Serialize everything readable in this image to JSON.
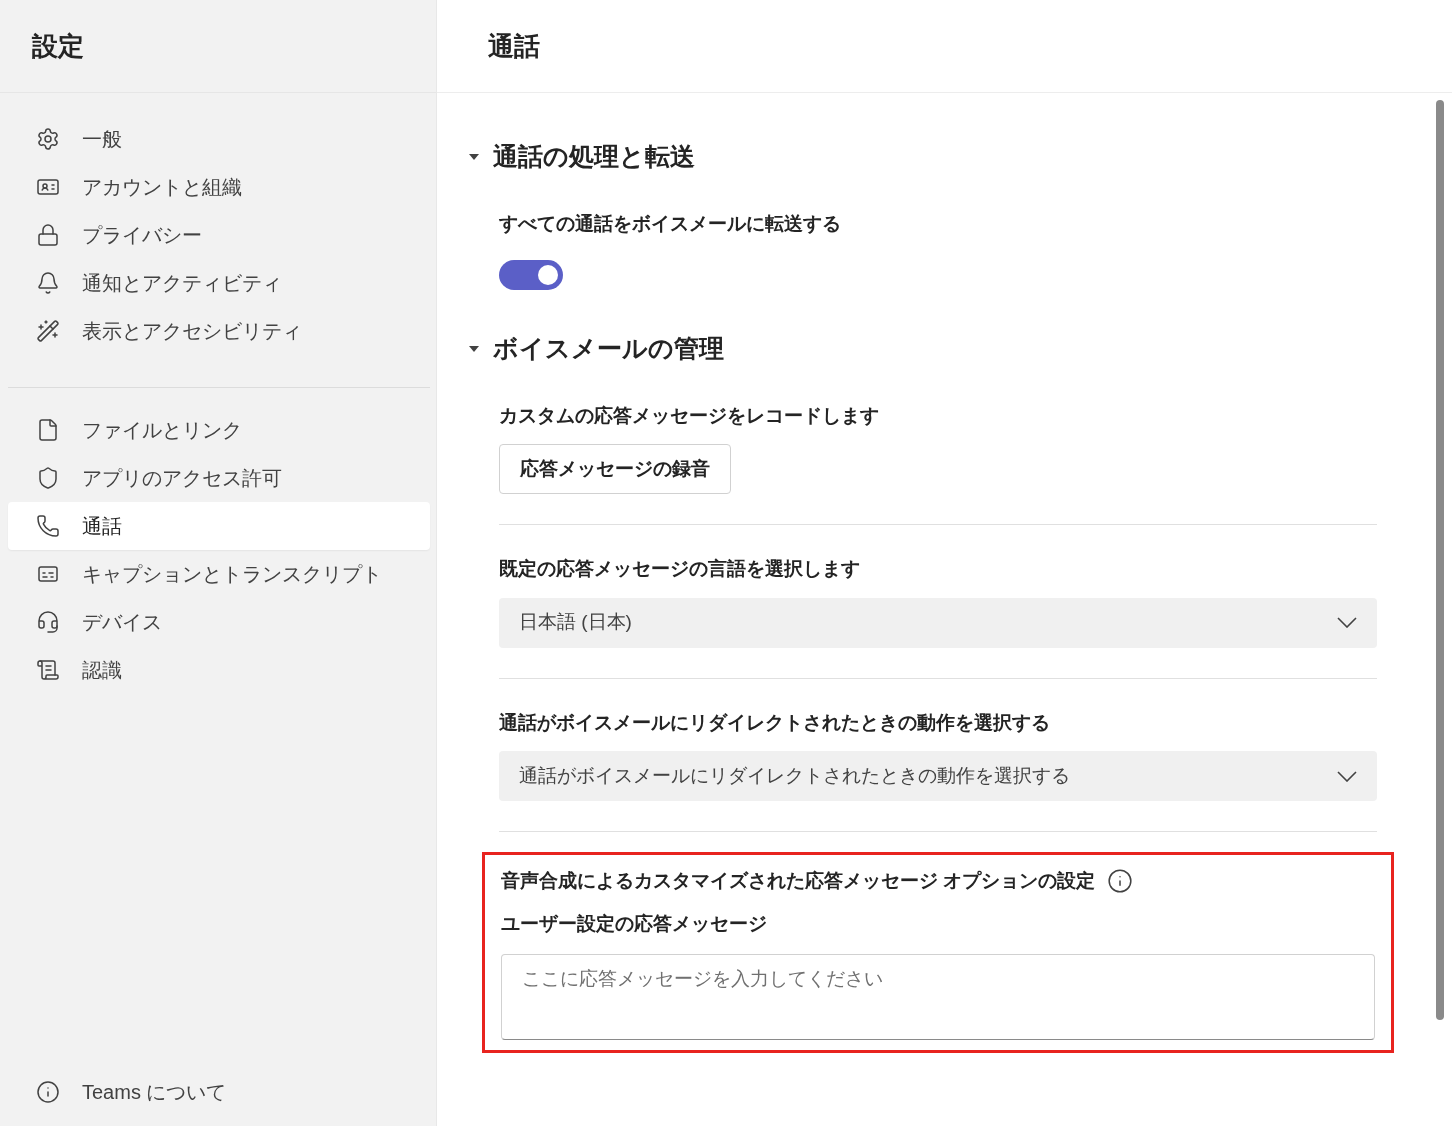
{
  "sidebar": {
    "title": "設定",
    "groups": [
      {
        "items": [
          {
            "label": "一般",
            "selected": false
          },
          {
            "label": "アカウントと組織",
            "selected": false
          },
          {
            "label": "プライバシー",
            "selected": false
          },
          {
            "label": "通知とアクティビティ",
            "selected": false
          },
          {
            "label": "表示とアクセシビリティ",
            "selected": false
          }
        ]
      },
      {
        "items": [
          {
            "label": "ファイルとリンク",
            "selected": false
          },
          {
            "label": "アプリのアクセス許可",
            "selected": false
          },
          {
            "label": "通話",
            "selected": true
          },
          {
            "label": "キャプションとトランスクリプト",
            "selected": false
          },
          {
            "label": "デバイス",
            "selected": false
          },
          {
            "label": "認識",
            "selected": false
          }
        ]
      }
    ],
    "footer": {
      "label": "Teams について"
    }
  },
  "main": {
    "title": "通話",
    "sections": [
      {
        "title": "通話の処理と転送",
        "expanded": true,
        "settings": [
          {
            "kind": "toggle",
            "label": "すべての通話をボイスメールに転送する",
            "on": true
          }
        ]
      },
      {
        "title": "ボイスメールの管理",
        "expanded": true,
        "settings": [
          {
            "kind": "button",
            "label": "カスタムの応答メッセージをレコードします",
            "button": "応答メッセージの録音"
          },
          {
            "kind": "select",
            "label": "既定の応答メッセージの言語を選択します",
            "value": "日本語 (日本)"
          },
          {
            "kind": "select",
            "label": "通話がボイスメールにリダイレクトされたときの動作を選択する",
            "value": "通話がボイスメールにリダイレクトされたときの動作を選択する"
          },
          {
            "kind": "text",
            "label": "音声合成によるカスタマイズされた応答メッセージ オプションの設定",
            "sublabel": "ユーザー設定の応答メッセージ",
            "placeholder": "ここに応答メッセージを入力してください",
            "highlighted": true
          }
        ]
      }
    ]
  }
}
